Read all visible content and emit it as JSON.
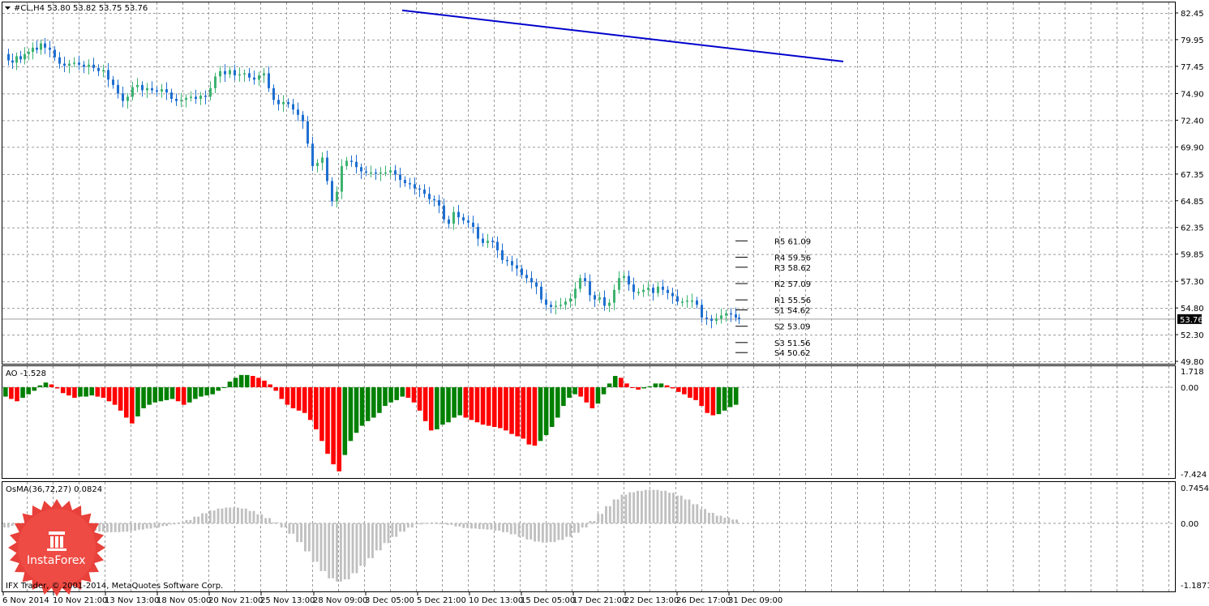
{
  "colors": {
    "background": "#ffffff",
    "grid": "#9a9a9a",
    "text": "#000000",
    "candle_bull": "#3cb371",
    "candle_bear": "#1e6fd0",
    "trendline": "#0000cc",
    "ao_up": "#008000",
    "ao_down": "#ff0000",
    "osma": "#c0c0c0",
    "price_tag_bg": "#000000",
    "price_tag_text": "#ffffff"
  },
  "main_panel": {
    "header": "#CL,H4  53.80 53.82 53.75 53.76",
    "current_price": "53.76",
    "price_ticks": [
      "82.45",
      "79.95",
      "77.45",
      "74.90",
      "72.40",
      "69.90",
      "67.35",
      "64.85",
      "62.35",
      "59.85",
      "57.30",
      "54.80",
      "52.30",
      "49.80"
    ]
  },
  "pivots": [
    {
      "label": "R5 61.09",
      "value": 61.09
    },
    {
      "label": "R4 59.56",
      "value": 59.56
    },
    {
      "label": "R3 58.62",
      "value": 58.62
    },
    {
      "label": "R2 57.09",
      "value": 57.09
    },
    {
      "label": "R1 55.56",
      "value": 55.56
    },
    {
      "label": "S1 54.62",
      "value": 54.62
    },
    {
      "label": "S2 53.09",
      "value": 53.09
    },
    {
      "label": "S3 51.56",
      "value": 51.56
    },
    {
      "label": "S4 50.62",
      "value": 50.62
    }
  ],
  "ao_panel": {
    "label": "AO -1.528",
    "ticks": [
      "1.718",
      "0.00",
      "-7.424"
    ]
  },
  "osma_panel": {
    "label": "OsMA(36,72,27) 0.0824",
    "ticks": [
      "0.7454",
      "0.00",
      "-1.1871"
    ]
  },
  "x_axis": [
    "6 Nov 2014",
    "10 Nov 21:00",
    "13 Nov 13:00",
    "18 Nov 05:00",
    "20 Nov 21:00",
    "25 Nov 13:00",
    "28 Nov 09:00",
    "3 Dec 05:00",
    "5 Dec 21:00",
    "10 Dec 13:00",
    "15 Dec 05:00",
    "17 Dec 21:00",
    "22 Dec 13:00",
    "26 Dec 17:00",
    "31 Dec 09:00"
  ],
  "footer": "IFX Trader, © 2001-2014, MetaQuotes Software Corp.",
  "logo": {
    "text": "InstaForex"
  },
  "chart_data": {
    "type": "line",
    "title": "#CL,H4",
    "ylim": [
      49.8,
      82.45
    ],
    "grid": true,
    "points": [
      [
        0,
        78.6
      ],
      [
        5,
        78.0
      ],
      [
        10,
        77.8
      ],
      [
        15,
        78.4
      ],
      [
        20,
        78.1
      ],
      [
        25,
        78.6
      ],
      [
        30,
        78.8
      ],
      [
        35,
        79.2
      ],
      [
        40,
        79.0
      ],
      [
        45,
        79.6
      ],
      [
        50,
        79.2
      ],
      [
        56,
        79.0
      ],
      [
        62,
        78.3
      ],
      [
        68,
        77.7
      ],
      [
        74,
        77.5
      ],
      [
        80,
        77.7
      ],
      [
        86,
        77.8
      ],
      [
        92,
        77.6
      ],
      [
        98,
        77.4
      ],
      [
        104,
        77.6
      ],
      [
        110,
        77.3
      ],
      [
        116,
        77.0
      ],
      [
        122,
        77.1
      ],
      [
        128,
        76.2
      ],
      [
        134,
        75.7
      ],
      [
        140,
        74.9
      ],
      [
        146,
        74.2
      ],
      [
        152,
        74.6
      ],
      [
        158,
        75.5
      ],
      [
        164,
        75.7
      ],
      [
        170,
        75.2
      ],
      [
        176,
        75.4
      ],
      [
        182,
        75.2
      ],
      [
        188,
        75.1
      ],
      [
        194,
        75.3
      ],
      [
        200,
        75.0
      ],
      [
        206,
        74.4
      ],
      [
        212,
        74.2
      ],
      [
        218,
        74.3
      ],
      [
        224,
        74.5
      ],
      [
        230,
        74.6
      ],
      [
        236,
        74.4
      ],
      [
        242,
        74.7
      ],
      [
        248,
        74.6
      ],
      [
        254,
        75.4
      ],
      [
        260,
        76.5
      ],
      [
        266,
        77.0
      ],
      [
        272,
        76.7
      ],
      [
        278,
        77.1
      ],
      [
        284,
        76.6
      ],
      [
        290,
        76.7
      ],
      [
        296,
        76.8
      ],
      [
        302,
        76.4
      ],
      [
        308,
        76.2
      ],
      [
        314,
        76.6
      ],
      [
        320,
        76.8
      ],
      [
        326,
        75.4
      ],
      [
        332,
        74.3
      ],
      [
        338,
        73.9
      ],
      [
        344,
        74.1
      ],
      [
        350,
        73.9
      ],
      [
        356,
        73.4
      ],
      [
        362,
        72.9
      ],
      [
        368,
        72.3
      ],
      [
        374,
        70.2
      ],
      [
        380,
        68.1
      ],
      [
        386,
        68.4
      ],
      [
        392,
        68.9
      ],
      [
        398,
        66.7
      ],
      [
        404,
        64.8
      ],
      [
        410,
        65.7
      ],
      [
        416,
        68.1
      ],
      [
        422,
        68.6
      ],
      [
        428,
        68.5
      ],
      [
        434,
        68.0
      ],
      [
        440,
        67.6
      ],
      [
        446,
        67.5
      ],
      [
        452,
        67.5
      ],
      [
        458,
        67.4
      ],
      [
        464,
        67.5
      ],
      [
        470,
        67.5
      ],
      [
        476,
        67.7
      ],
      [
        482,
        67.3
      ],
      [
        488,
        66.8
      ],
      [
        494,
        66.5
      ],
      [
        500,
        66.4
      ],
      [
        506,
        66.0
      ],
      [
        512,
        65.9
      ],
      [
        518,
        65.5
      ],
      [
        524,
        65.0
      ],
      [
        530,
        64.9
      ],
      [
        536,
        64.4
      ],
      [
        542,
        63.1
      ],
      [
        548,
        62.7
      ],
      [
        554,
        63.8
      ],
      [
        560,
        63.3
      ],
      [
        566,
        63.0
      ],
      [
        572,
        62.8
      ],
      [
        578,
        62.4
      ],
      [
        584,
        61.3
      ],
      [
        590,
        60.9
      ],
      [
        596,
        61.1
      ],
      [
        602,
        61.0
      ],
      [
        608,
        60.2
      ],
      [
        614,
        59.3
      ],
      [
        620,
        59.2
      ],
      [
        626,
        58.8
      ],
      [
        632,
        58.5
      ],
      [
        638,
        57.9
      ],
      [
        644,
        57.6
      ],
      [
        650,
        57.2
      ],
      [
        656,
        56.8
      ],
      [
        662,
        55.6
      ],
      [
        668,
        55.1
      ],
      [
        674,
        54.9
      ],
      [
        680,
        55.0
      ],
      [
        686,
        55.1
      ],
      [
        692,
        55.4
      ],
      [
        698,
        55.7
      ],
      [
        704,
        56.6
      ],
      [
        710,
        57.6
      ],
      [
        716,
        57.3
      ],
      [
        722,
        56.0
      ],
      [
        728,
        55.6
      ],
      [
        734,
        55.8
      ],
      [
        740,
        55.0
      ],
      [
        746,
        55.3
      ],
      [
        752,
        56.5
      ],
      [
        758,
        57.6
      ],
      [
        764,
        57.8
      ],
      [
        770,
        57.0
      ],
      [
        776,
        56.3
      ],
      [
        782,
        56.3
      ],
      [
        788,
        56.5
      ],
      [
        794,
        56.7
      ],
      [
        800,
        56.2
      ],
      [
        806,
        56.8
      ],
      [
        812,
        56.5
      ],
      [
        818,
        56.2
      ],
      [
        824,
        55.9
      ],
      [
        830,
        55.4
      ],
      [
        836,
        55.4
      ],
      [
        842,
        55.5
      ],
      [
        848,
        55.5
      ],
      [
        854,
        55.1
      ],
      [
        860,
        53.9
      ],
      [
        866,
        53.8
      ],
      [
        872,
        53.6
      ],
      [
        878,
        53.8
      ],
      [
        884,
        54.1
      ],
      [
        890,
        54.3
      ],
      [
        896,
        54.2
      ],
      [
        902,
        53.9
      ],
      [
        906,
        53.76
      ]
    ],
    "trendline": {
      "from": [
        496,
        82.7
      ],
      "to": [
        1040,
        77.9
      ]
    },
    "ao": {
      "ylim": [
        -7.424,
        1.718
      ],
      "values": [
        -0.8,
        -1.0,
        -1.2,
        -0.9,
        -0.6,
        -0.3,
        0.2,
        0.5,
        0.3,
        -0.1,
        -0.5,
        -0.7,
        -0.9,
        -0.8,
        -0.8,
        -0.7,
        -0.8,
        -0.9,
        -1.2,
        -1.5,
        -2.0,
        -2.6,
        -3.1,
        -2.5,
        -1.8,
        -1.5,
        -1.3,
        -1.2,
        -1.1,
        -1.0,
        -1.2,
        -1.5,
        -1.3,
        -1.0,
        -0.8,
        -0.7,
        -0.6,
        -0.3,
        0.0,
        0.6,
        1.0,
        1.3,
        1.3,
        1.2,
        1.0,
        0.7,
        0.3,
        -0.3,
        -1.0,
        -1.5,
        -1.8,
        -2.0,
        -2.2,
        -2.8,
        -3.6,
        -4.6,
        -5.7,
        -6.6,
        -7.2,
        -5.8,
        -4.6,
        -3.9,
        -3.3,
        -2.9,
        -2.6,
        -2.2,
        -1.6,
        -1.3,
        -1.1,
        -0.8,
        -0.9,
        -1.3,
        -2.0,
        -2.9,
        -3.7,
        -3.6,
        -3.2,
        -3.0,
        -2.6,
        -2.4,
        -2.6,
        -2.8,
        -3.0,
        -3.2,
        -3.3,
        -3.4,
        -3.5,
        -3.7,
        -4.0,
        -4.2,
        -4.4,
        -4.9,
        -5.0,
        -4.6,
        -4.1,
        -3.4,
        -2.6,
        -1.6,
        -0.9,
        -0.6,
        -0.8,
        -1.3,
        -1.8,
        -1.4,
        -0.6,
        0.4,
        1.2,
        1.0,
        0.4,
        0.0,
        -0.2,
        -0.1,
        0.1,
        0.4,
        0.4,
        0.2,
        -0.1,
        -0.4,
        -0.6,
        -0.9,
        -1.1,
        -1.6,
        -2.2,
        -2.4,
        -2.3,
        -2.0,
        -1.7,
        -1.5
      ]
    },
    "osma": {
      "ylim": [
        -1.1871,
        0.7454
      ],
      "values": [
        -0.08,
        -0.05,
        -0.02,
        0.01,
        0.04,
        0.05,
        0.04,
        0.02,
        -0.01,
        -0.05,
        -0.1,
        -0.14,
        -0.16,
        -0.17,
        -0.17,
        -0.16,
        -0.14,
        -0.12,
        -0.1,
        -0.08,
        -0.05,
        -0.02,
        0.02,
        0.07,
        0.14,
        0.21,
        0.27,
        0.31,
        0.33,
        0.33,
        0.31,
        0.26,
        0.19,
        0.11,
        0.02,
        -0.08,
        -0.2,
        -0.36,
        -0.54,
        -0.74,
        -0.92,
        -1.06,
        -1.12,
        -1.08,
        -0.96,
        -0.82,
        -0.67,
        -0.52,
        -0.38,
        -0.26,
        -0.16,
        -0.08,
        -0.02,
        0.01,
        0.02,
        0.0,
        -0.03,
        -0.06,
        -0.09,
        -0.1,
        -0.11,
        -0.12,
        -0.14,
        -0.17,
        -0.21,
        -0.26,
        -0.31,
        -0.35,
        -0.37,
        -0.36,
        -0.32,
        -0.26,
        -0.18,
        -0.08,
        0.05,
        0.2,
        0.36,
        0.5,
        0.6,
        0.65,
        0.68,
        0.7,
        0.7,
        0.68,
        0.64,
        0.58,
        0.5,
        0.4,
        0.3,
        0.22,
        0.16,
        0.12,
        0.08
      ]
    }
  }
}
